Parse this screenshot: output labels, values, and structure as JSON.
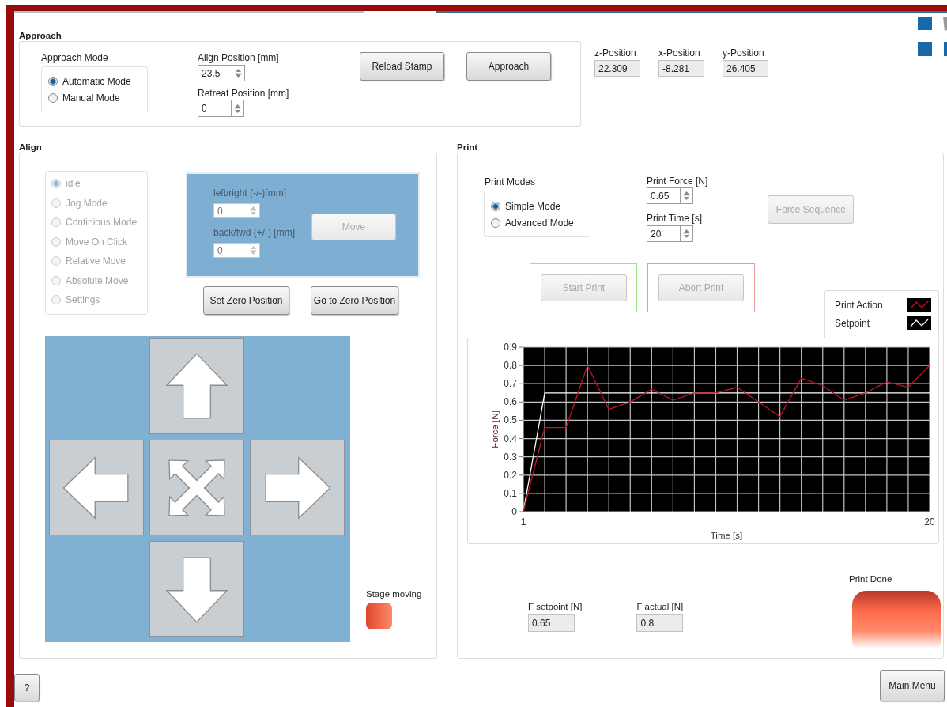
{
  "approach": {
    "title": "Approach",
    "mode_label": "Approach Mode",
    "modes": [
      {
        "label": "Automatic Mode",
        "selected": true
      },
      {
        "label": "Manual Mode",
        "selected": false
      }
    ],
    "align_position": {
      "label": "Align Position [mm]",
      "value": "23.5"
    },
    "retreat_position": {
      "label": "Retreat Position [mm]",
      "value": "0"
    },
    "buttons": [
      {
        "label": "Reload Stamp"
      },
      {
        "label": "Approach"
      }
    ]
  },
  "positions": [
    {
      "label": "z-Position",
      "value": "22.309"
    },
    {
      "label": "x-Position",
      "value": "-8.281"
    },
    {
      "label": "y-Position",
      "value": "26.405"
    }
  ],
  "align": {
    "title": "Align",
    "modes": [
      {
        "label": "idle",
        "selected": true,
        "disabled": true
      },
      {
        "label": "Jog Mode",
        "selected": false,
        "disabled": true
      },
      {
        "label": "Continious Mode",
        "selected": false,
        "disabled": true
      },
      {
        "label": "Move On Click",
        "selected": false,
        "disabled": true
      },
      {
        "label": "Relative Move",
        "selected": false,
        "disabled": true
      },
      {
        "label": "Absolute Move",
        "selected": false,
        "disabled": true
      },
      {
        "label": "Settings",
        "selected": false,
        "disabled": true
      }
    ],
    "move_fields": [
      {
        "label": "left/right (-/-)[mm]",
        "value": "0",
        "disabled": true
      },
      {
        "label": "back/fwd (+/-) [mm]",
        "value": "0",
        "disabled": true
      }
    ],
    "move_button": {
      "label": "Move",
      "disabled": true
    },
    "buttons": [
      {
        "label": "Set Zero Position"
      },
      {
        "label": "Go to Zero Position"
      }
    ],
    "stage_moving": {
      "label": "Stage moving",
      "on": true
    }
  },
  "print": {
    "title": "Print",
    "mode_label": "Print Modes",
    "modes": [
      {
        "label": "Simple Mode",
        "selected": true
      },
      {
        "label": "Advanced Mode",
        "selected": false
      }
    ],
    "print_force": {
      "label": "Print Force [N]",
      "value": "0.65"
    },
    "print_time": {
      "label": "Print Time [s]",
      "value": "20"
    },
    "force_sequence": {
      "label": "Force Sequence",
      "disabled": true
    },
    "start_print": {
      "label": "Start Print",
      "disabled": true
    },
    "abort_print": {
      "label": "Abort Print",
      "disabled": true
    },
    "chart_data": {
      "type": "line",
      "grid": true,
      "xlabel": "Time [s]",
      "ylabel": "Force [N]",
      "x": [
        1,
        2,
        3,
        4,
        5,
        6,
        7,
        8,
        9,
        10,
        11,
        12,
        13,
        14,
        15,
        16,
        17,
        18,
        19,
        20
      ],
      "xlim": [
        1,
        20
      ],
      "ylim": [
        0,
        0.9
      ],
      "xticks": [
        1,
        20
      ],
      "yticks": [
        0,
        0.1,
        0.2,
        0.3,
        0.4,
        0.5,
        0.6,
        0.7,
        0.8,
        0.9
      ],
      "series": [
        {
          "name": "Print Action",
          "color": "#c0142a",
          "values": [
            0,
            0.46,
            0.46,
            0.8,
            0.56,
            0.6,
            0.67,
            0.61,
            0.65,
            0.65,
            0.68,
            0.6,
            0.52,
            0.73,
            0.69,
            0.61,
            0.65,
            0.71,
            0.68,
            0.8
          ]
        },
        {
          "name": "Setpoint",
          "color": "#ffffff",
          "values": [
            0,
            0.65,
            0.65,
            0.65,
            0.65,
            0.65,
            0.65,
            0.65,
            0.65,
            0.65,
            0.65,
            0.65,
            0.65,
            0.65,
            0.65,
            0.65,
            0.65,
            0.65,
            0.65,
            0.65
          ]
        }
      ]
    },
    "f_setpoint": {
      "label": "F setpoint [N]",
      "value": "0.65"
    },
    "f_actual": {
      "label": "F actual [N]",
      "value": "0.8"
    },
    "print_done": {
      "label": "Print Done",
      "on": true
    }
  },
  "help_button": {
    "label": "?"
  },
  "main_menu_button": {
    "label": "Main Menu"
  }
}
